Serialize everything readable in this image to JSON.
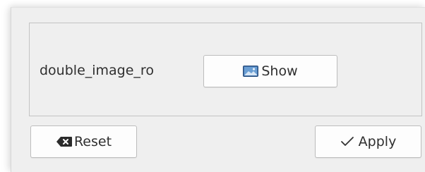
{
  "dialog": {
    "field": {
      "label": "double_image_ro",
      "show_button_label": "Show",
      "show_icon": "image-icon"
    },
    "buttons": {
      "reset_label": "Reset",
      "reset_icon": "backspace-clear-icon",
      "apply_label": "Apply",
      "apply_icon": "checkmark-icon"
    }
  }
}
